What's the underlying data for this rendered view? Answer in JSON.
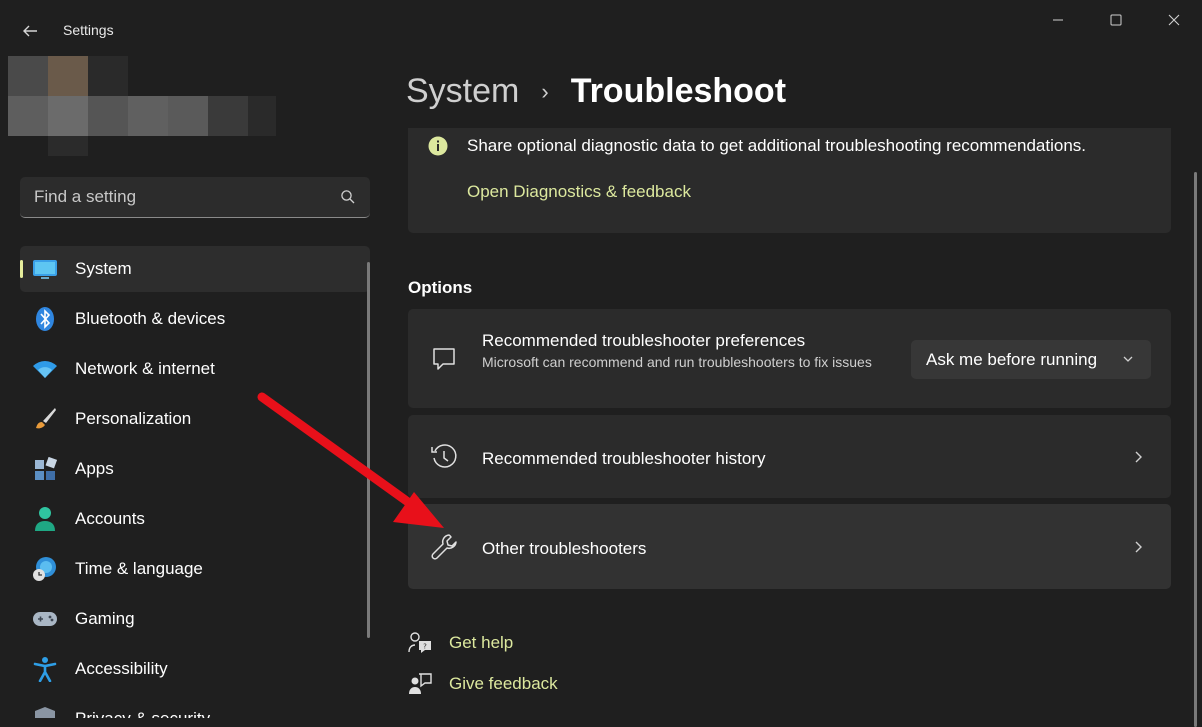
{
  "window": {
    "title": "Settings"
  },
  "search": {
    "placeholder": "Find a setting"
  },
  "sidebar": {
    "items": [
      {
        "label": "System",
        "icon": "system-display-icon",
        "active": true
      },
      {
        "label": "Bluetooth & devices",
        "icon": "bluetooth-icon"
      },
      {
        "label": "Network & internet",
        "icon": "wifi-icon"
      },
      {
        "label": "Personalization",
        "icon": "paintbrush-icon"
      },
      {
        "label": "Apps",
        "icon": "apps-icon"
      },
      {
        "label": "Accounts",
        "icon": "accounts-icon"
      },
      {
        "label": "Time & language",
        "icon": "globe-clock-icon"
      },
      {
        "label": "Gaming",
        "icon": "gamepad-icon"
      },
      {
        "label": "Accessibility",
        "icon": "accessibility-icon"
      },
      {
        "label": "Privacy & security",
        "icon": "shield-icon"
      }
    ]
  },
  "breadcrumb": {
    "parent": "System",
    "separator": "›",
    "current": "Troubleshoot"
  },
  "diagnostics": {
    "message": "Share optional diagnostic data to get additional troubleshooting recommendations.",
    "link": "Open Diagnostics & feedback"
  },
  "options": {
    "heading": "Options",
    "preferences": {
      "title": "Recommended troubleshooter preferences",
      "description": "Microsoft can recommend and run troubleshooters to fix issues",
      "dropdown_value": "Ask me before running"
    },
    "history": {
      "title": "Recommended troubleshooter history"
    },
    "other": {
      "title": "Other troubleshooters"
    }
  },
  "footer_links": {
    "help": "Get help",
    "feedback": "Give feedback"
  },
  "colors": {
    "background": "#1f1f1f",
    "card": "#2b2b2b",
    "accent_link": "#dce89e",
    "active_indicator": "#e6ee9c",
    "annotation_arrow": "#e8101a"
  }
}
